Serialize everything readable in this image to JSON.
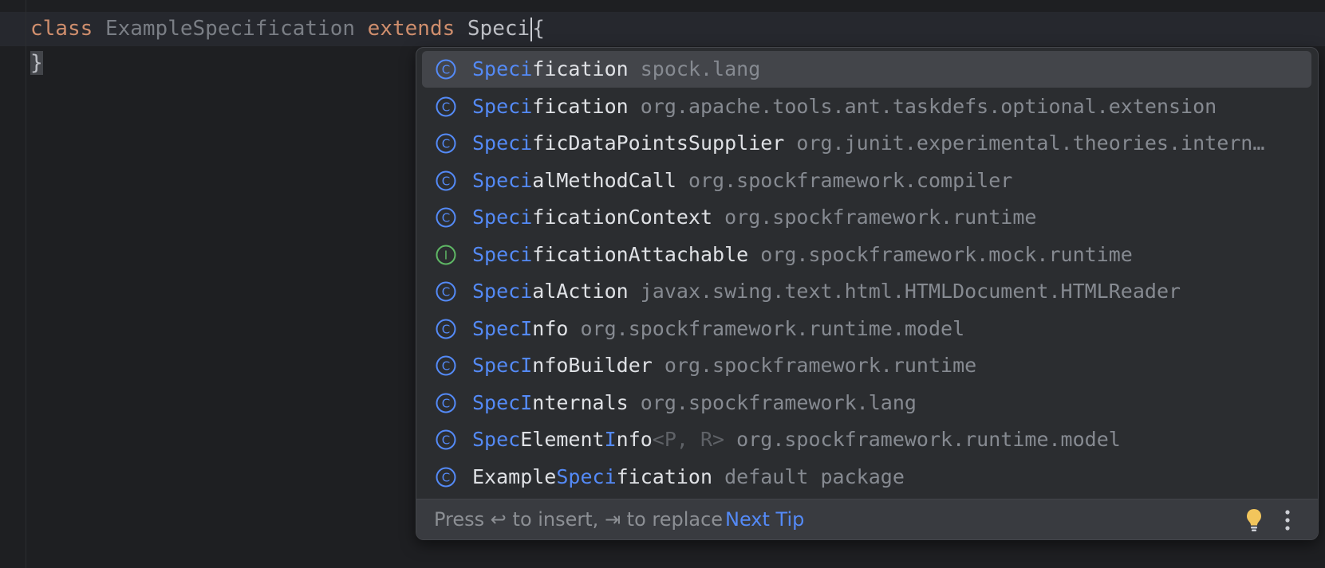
{
  "editor": {
    "line1": {
      "kw1": "class",
      "class_name": "ExampleSpecification",
      "kw2": "extends",
      "typed": "Speci",
      "brace": "{"
    },
    "line2": {
      "brace": "}"
    }
  },
  "completion": {
    "items": [
      {
        "icon": "class-icon",
        "match": "Speci",
        "rest": "fication",
        "generics": "",
        "pkg": "spock.lang",
        "selected": true
      },
      {
        "icon": "class-icon",
        "match": "Speci",
        "rest": "fication",
        "generics": "",
        "pkg": "org.apache.tools.ant.taskdefs.optional.extension"
      },
      {
        "icon": "class-icon",
        "match": "Speci",
        "rest": "ficDataPointsSupplier",
        "generics": "",
        "pkg": "org.junit.experimental.theories.intern…"
      },
      {
        "icon": "class-icon",
        "match": "Speci",
        "rest": "alMethodCall",
        "generics": "",
        "pkg": "org.spockframework.compiler"
      },
      {
        "icon": "class-icon",
        "match": "Speci",
        "rest": "ficationContext",
        "generics": "",
        "pkg": "org.spockframework.runtime"
      },
      {
        "icon": "interface-icon",
        "match": "Speci",
        "rest": "ficationAttachable",
        "generics": "",
        "pkg": "org.spockframework.mock.runtime"
      },
      {
        "icon": "class-icon",
        "match": "Speci",
        "rest": "alAction",
        "generics": "",
        "pkg": "javax.swing.text.html.HTMLDocument.HTMLReader"
      },
      {
        "icon": "class-icon",
        "match": "Spec",
        "rest": "",
        "match2": "I",
        "rest2": "nfo",
        "generics": "",
        "pkg": "org.spockframework.runtime.model"
      },
      {
        "icon": "class-icon",
        "match": "Spec",
        "rest": "",
        "match2": "I",
        "rest2": "nfoBuilder",
        "generics": "",
        "pkg": "org.spockframework.runtime"
      },
      {
        "icon": "class-icon",
        "match": "Spec",
        "rest": "",
        "match2": "I",
        "rest2": "nternals",
        "generics": "",
        "pkg": "org.spockframework.lang"
      },
      {
        "icon": "class-icon",
        "match": "Spec",
        "rest": "Element",
        "match2": "I",
        "rest2": "nfo",
        "generics": "<P, R>",
        "pkg": "org.spockframework.runtime.model"
      },
      {
        "icon": "class-icon",
        "prefix": "Example",
        "match": "Speci",
        "rest": "fication",
        "generics": "",
        "pkg": "default package"
      }
    ],
    "footer": {
      "hint": "Press ↩ to insert, ⇥ to replace",
      "next_tip": "Next Tip"
    }
  },
  "colors": {
    "match": "#548af7",
    "keyword": "#cf8e6d",
    "interface_icon": "#5fb865",
    "class_icon": "#548af7"
  }
}
